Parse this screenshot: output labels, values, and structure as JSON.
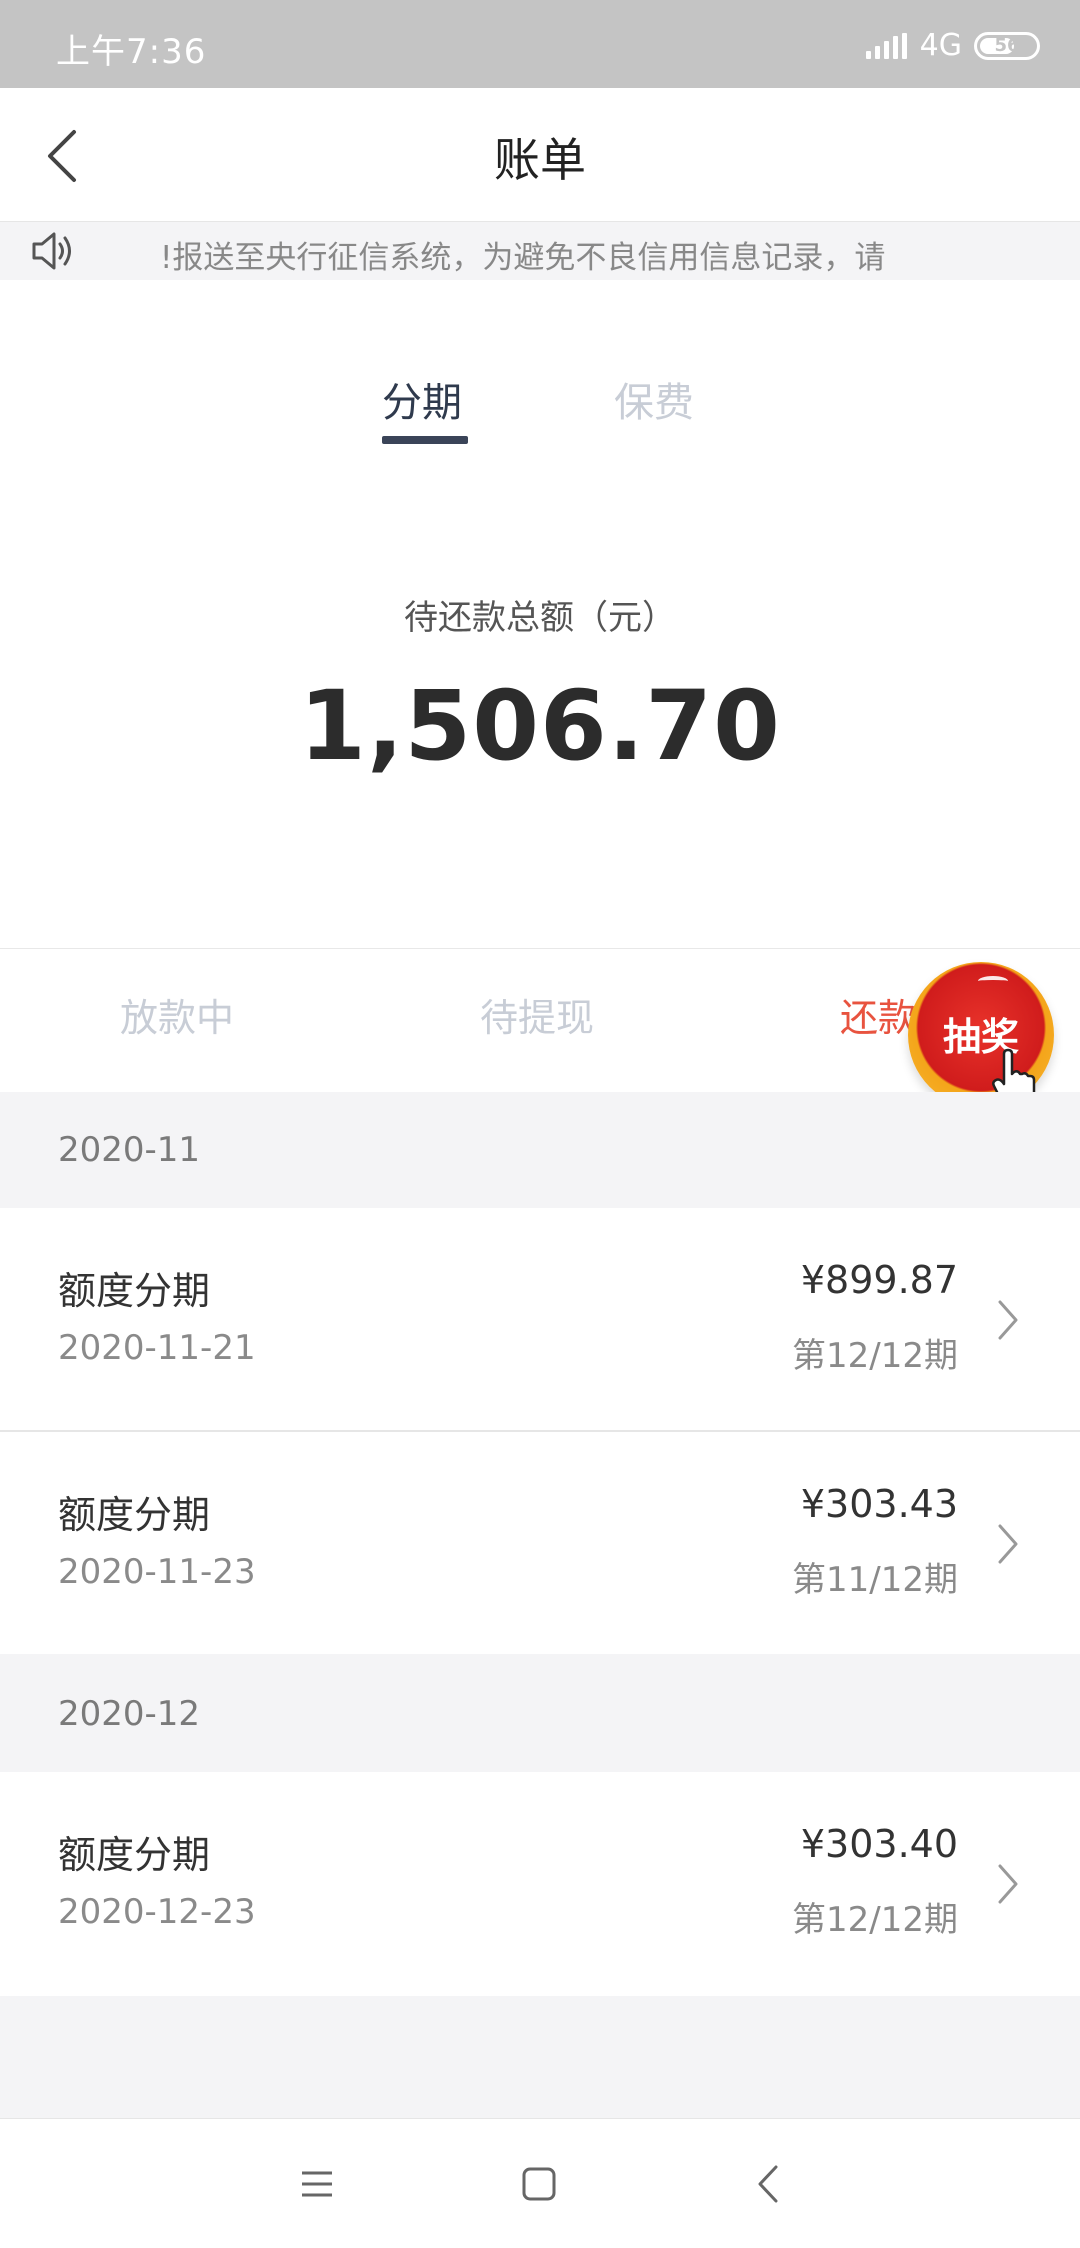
{
  "status_bar": {
    "time": "上午7:36",
    "network": "4G",
    "battery": "56",
    "battery_percent": 56
  },
  "nav": {
    "title": "账单",
    "back_icon": "chevron-left-icon"
  },
  "notice": {
    "icon": "speaker-icon",
    "text": "!报送至央行征信系统，为避免不良信用信息记录，请"
  },
  "tabs": [
    {
      "label": "分期",
      "active": true
    },
    {
      "label": "保费",
      "active": false
    }
  ],
  "summary": {
    "label": "待还款总额（元）",
    "amount": "1,506.70"
  },
  "subtabs": [
    {
      "label": "放款中"
    },
    {
      "label": "待提现"
    },
    {
      "label": "还款"
    }
  ],
  "lottery": {
    "label": "抽奖"
  },
  "groups": [
    {
      "month": "2020-11",
      "items": [
        {
          "name": "额度分期",
          "date": "2020-11-21",
          "amount": "¥899.87",
          "period": "第12/12期"
        },
        {
          "name": "额度分期",
          "date": "2020-11-23",
          "amount": "¥303.43",
          "period": "第11/12期"
        }
      ]
    },
    {
      "month": "2020-12",
      "items": [
        {
          "name": "额度分期",
          "date": "2020-12-23",
          "amount": "¥303.40",
          "period": "第12/12期"
        }
      ]
    }
  ],
  "colors": {
    "accent_red": "#e8533f",
    "tab_active": "#2f3a4d",
    "status_bar_bg": "#c4c4c4"
  }
}
